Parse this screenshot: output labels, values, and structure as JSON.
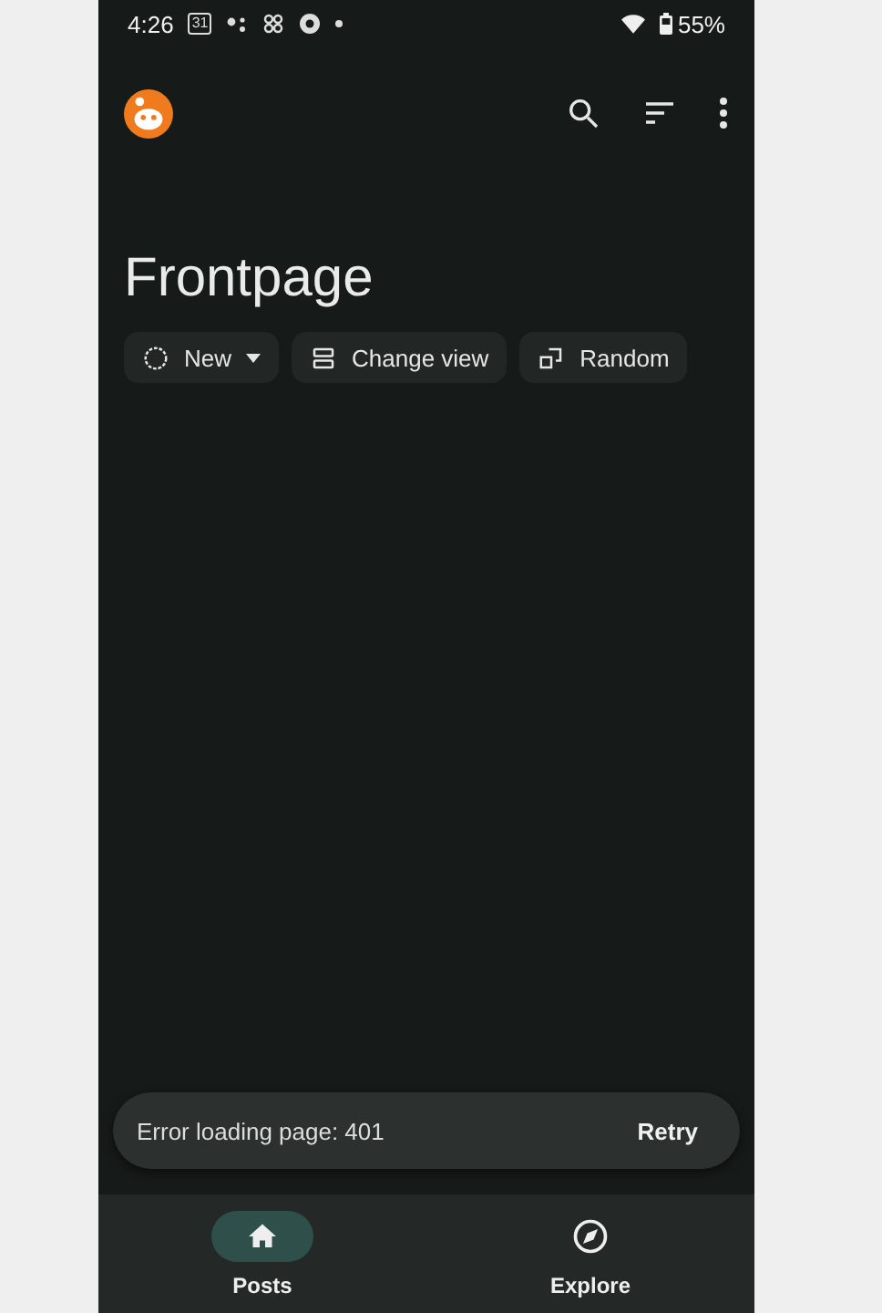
{
  "status_bar": {
    "time": "4:26",
    "calendar_day": "31",
    "battery": "55%"
  },
  "title": "Frontpage",
  "chips": [
    {
      "kind": "sort",
      "label": "New"
    },
    {
      "kind": "view",
      "label": "Change view"
    },
    {
      "kind": "random",
      "label": "Random"
    }
  ],
  "snackbar": {
    "message": "Error loading page: 401",
    "action": "Retry"
  },
  "nav": [
    {
      "kind": "home",
      "label": "Posts",
      "selected": true
    },
    {
      "kind": "explore",
      "label": "Explore",
      "selected": false
    }
  ]
}
